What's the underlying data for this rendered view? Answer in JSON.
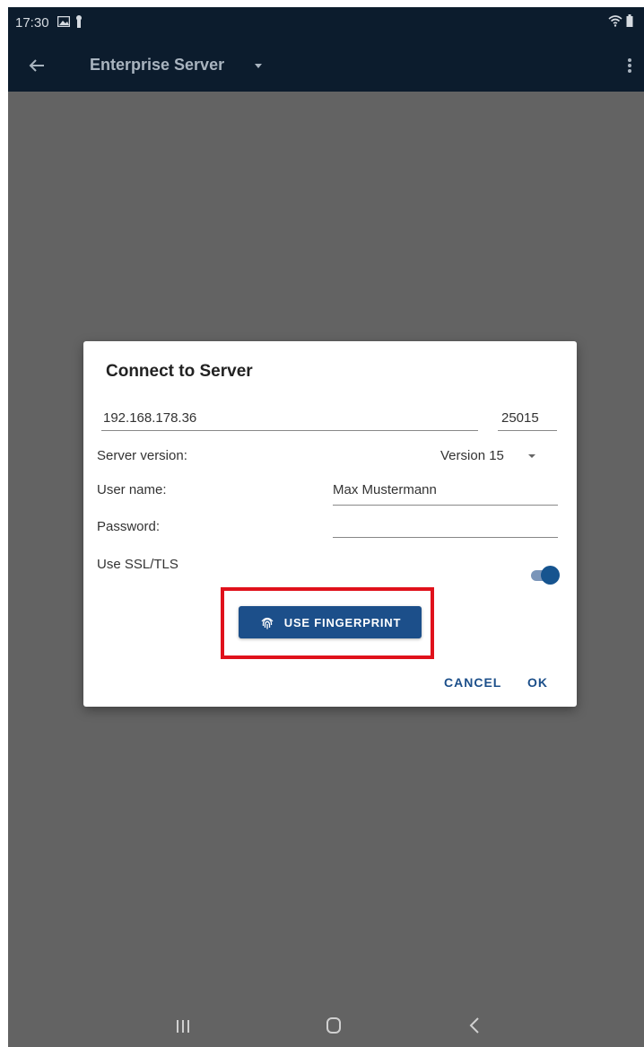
{
  "status_bar": {
    "time": "17:30",
    "icons": [
      "gallery-icon",
      "notification-icon",
      "wifi-icon",
      "battery-icon"
    ]
  },
  "app_bar": {
    "title": "Enterprise Server",
    "icons": [
      "back-arrow-icon",
      "dropdown-caret-icon",
      "more-vert-icon"
    ]
  },
  "dialog": {
    "title": "Connect to Server",
    "host": "192.168.178.36",
    "port": "25015",
    "server_version_label": "Server version:",
    "server_version_value": "Version 15",
    "username_label": "User name:",
    "username_value": "Max Mustermann",
    "password_label": "Password:",
    "password_value": "",
    "ssl_label": "Use SSL/TLS",
    "ssl_enabled": true,
    "fingerprint_button_label": "USE FINGERPRINT",
    "cancel_label": "CANCEL",
    "ok_label": "OK"
  },
  "colors": {
    "accent": "#1c4f8a",
    "highlight_border": "#e0111b",
    "scrim": "#636363",
    "app_bar": "#0c1c2d"
  }
}
